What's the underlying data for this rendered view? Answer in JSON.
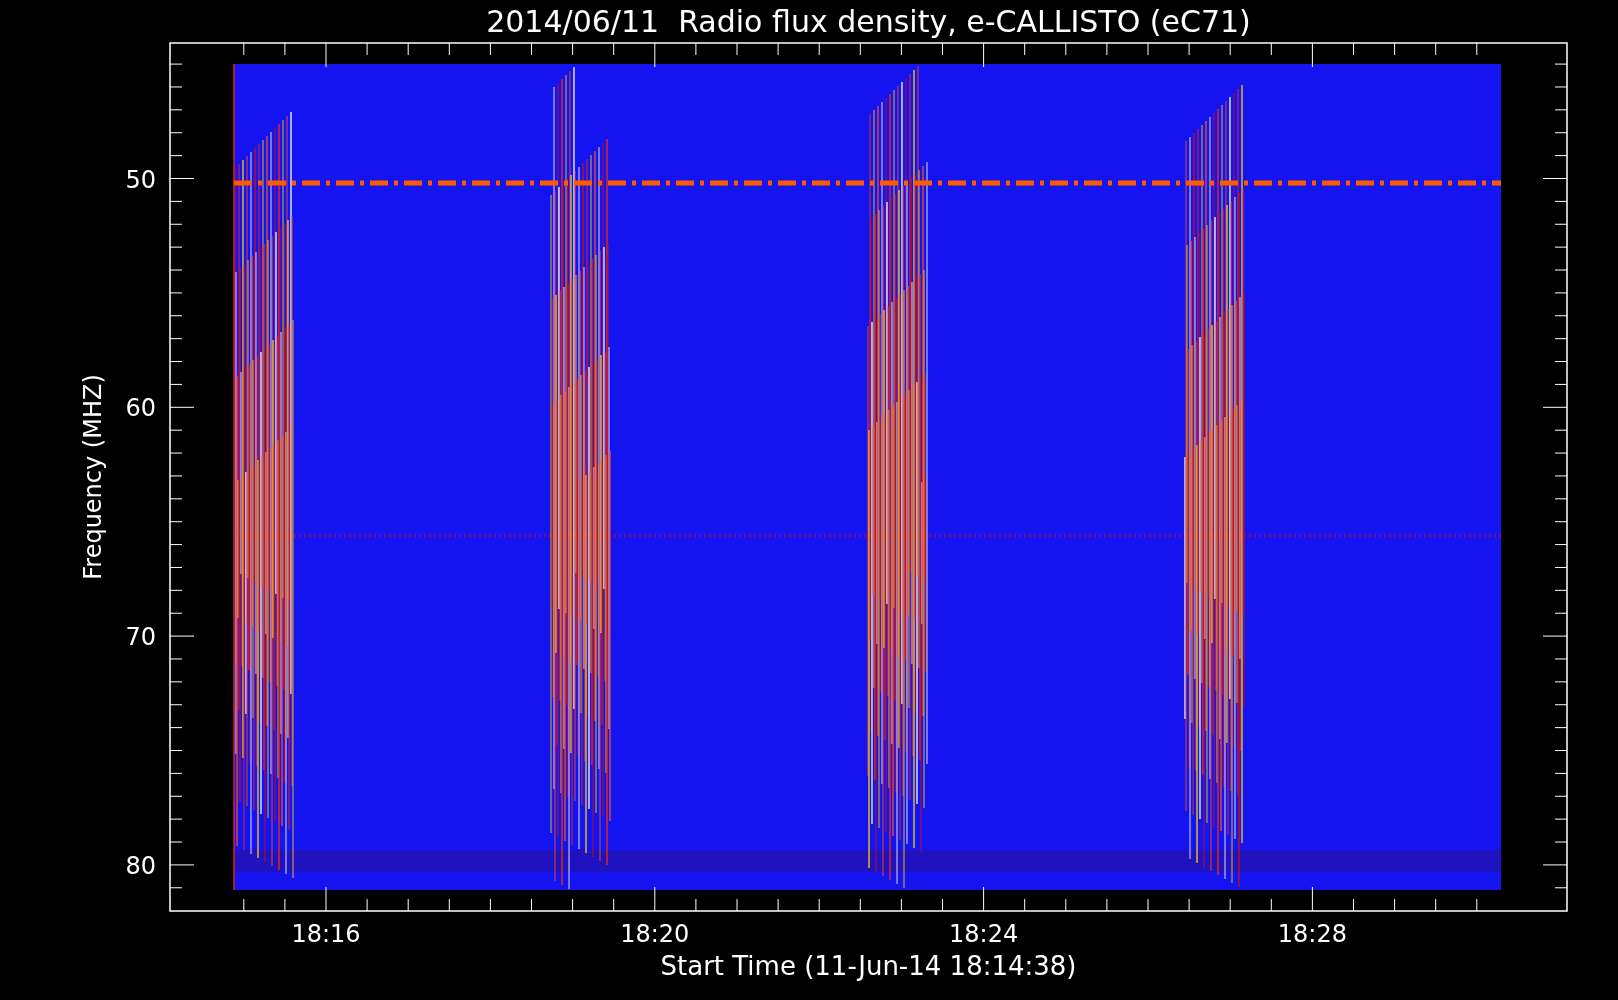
{
  "title": "2014/06/11  Radio flux density, e-CALLISTO (eC71)",
  "y_axis": {
    "label": "Frequency (MHZ)",
    "ticks": [
      "50",
      "60",
      "70",
      "80"
    ]
  },
  "x_axis": {
    "label": "Start Time (11-Jun-14 18:14:38)",
    "ticks": [
      "18:16",
      "18:20",
      "18:24",
      "18:28"
    ]
  }
}
